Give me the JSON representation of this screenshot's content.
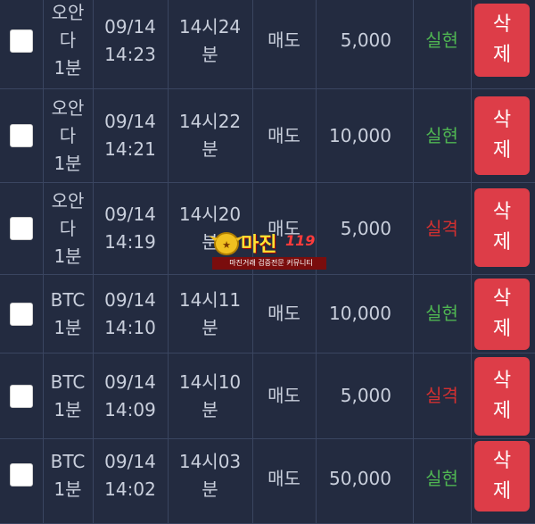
{
  "colors": {
    "success": "#4fb552",
    "fail": "#d23030",
    "delete": "#dd3d48"
  },
  "rows": [
    {
      "market": [
        "오안",
        "다",
        "1분"
      ],
      "date": [
        "09/14",
        "14:23"
      ],
      "round": [
        "14시24",
        "분"
      ],
      "side": "매도",
      "amount": "5,000",
      "status": "실현",
      "result": "success",
      "delete_label": [
        "삭",
        "제"
      ]
    },
    {
      "market": [
        "오안",
        "다",
        "1분"
      ],
      "date": [
        "09/14",
        "14:21"
      ],
      "round": [
        "14시22",
        "분"
      ],
      "side": "매도",
      "amount": "10,000",
      "status": "실현",
      "result": "success",
      "delete_label": [
        "삭",
        "제"
      ]
    },
    {
      "market": [
        "오안",
        "다",
        "1분"
      ],
      "date": [
        "09/14",
        "14:19"
      ],
      "round": [
        "14시20",
        "분"
      ],
      "side": "매도",
      "amount": "5,000",
      "status": "실격",
      "result": "fail",
      "delete_label": [
        "삭",
        "제"
      ]
    },
    {
      "market": [
        "BTC",
        "1분"
      ],
      "date": [
        "09/14",
        "14:10"
      ],
      "round": [
        "14시11",
        "분"
      ],
      "side": "매도",
      "amount": "10,000",
      "status": "실현",
      "result": "success",
      "delete_label": [
        "삭",
        "제"
      ]
    },
    {
      "market": [
        "BTC",
        "1분"
      ],
      "date": [
        "09/14",
        "14:09"
      ],
      "round": [
        "14시10",
        "분"
      ],
      "side": "매도",
      "amount": "5,000",
      "status": "실격",
      "result": "fail",
      "delete_label": [
        "삭",
        "제"
      ]
    },
    {
      "market": [
        "BTC",
        "1분"
      ],
      "date": [
        "09/14",
        "14:02"
      ],
      "round": [
        "14시03",
        "분"
      ],
      "side": "매도",
      "amount": "50,000",
      "status": "실현",
      "result": "success",
      "delete_label": [
        "삭",
        "제"
      ]
    }
  ],
  "watermark": {
    "title": "마진",
    "badge": "119",
    "subtitle": "마진거래 검증전문 커뮤니티"
  }
}
